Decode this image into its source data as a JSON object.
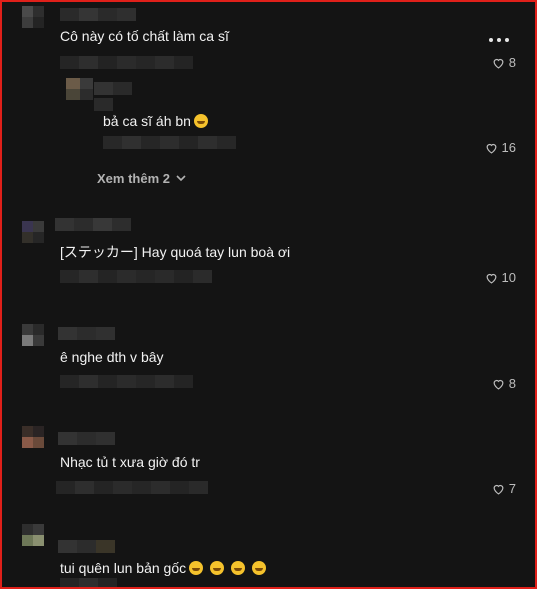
{
  "comments": [
    {
      "text": "Cô này có tố chất làm ca sĩ",
      "likes": "8"
    },
    {
      "text": "bả ca sĩ áh bn",
      "likes": "16",
      "reply": true
    },
    {
      "text": "[ステッカー] Hay quoá tay lun boà ơi",
      "likes": "10"
    },
    {
      "text": "ê nghe dth v bây",
      "likes": "8"
    },
    {
      "text": "Nhạc tủ t xưa giờ đó tr",
      "likes": "7"
    },
    {
      "text": "tui quên lun bản gốc",
      "likes": ""
    }
  ],
  "view_more": "Xem thêm 2",
  "icons": {
    "like": "heart-outline-icon",
    "more": "more-dots-icon",
    "expand": "chevron-down-icon",
    "emoji": "laughing-emoji-icon"
  },
  "colors": {
    "background": "#141414",
    "border": "#e0201a",
    "text": "#f2f2f2",
    "muted": "#bdbdbd"
  }
}
